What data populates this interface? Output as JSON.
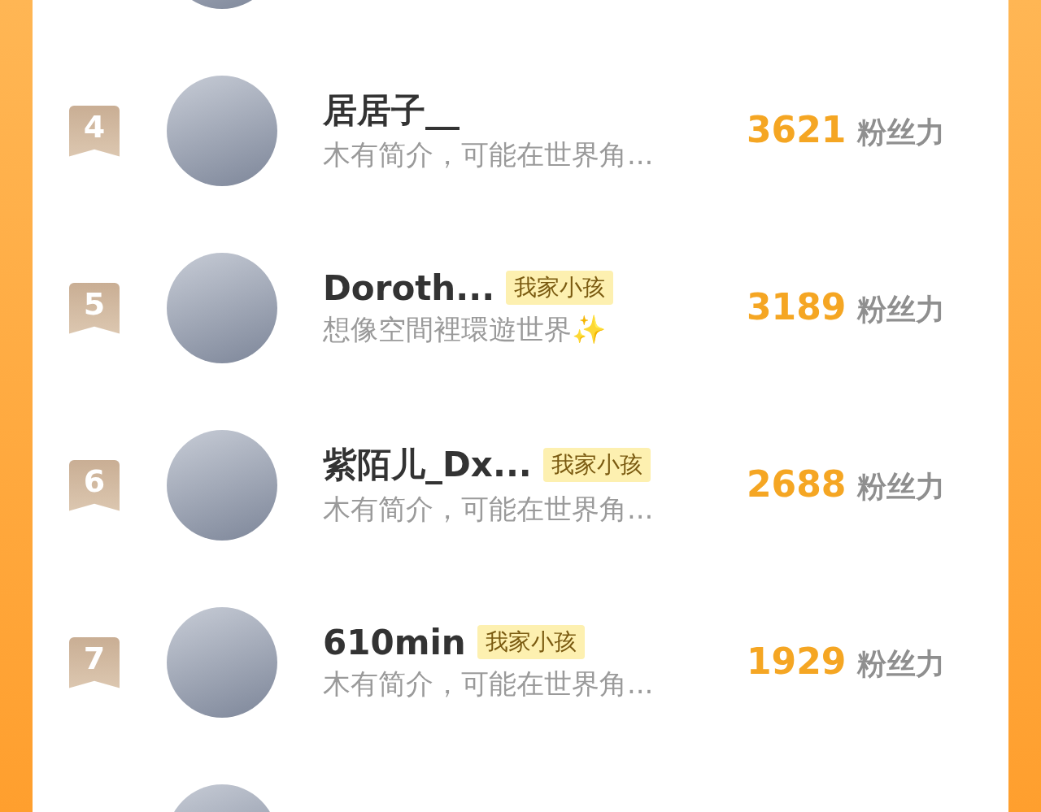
{
  "ranking": [
    {
      "rank": "4",
      "name": "居居子__",
      "bio": "木有简介，可能在世界角...",
      "score": "3621",
      "score_unit": "粉丝力"
    },
    {
      "rank": "5",
      "name": "Doroth...",
      "tag": "我家小孩",
      "bio": "想像空間裡環遊世界✨",
      "score": "3189",
      "score_unit": "粉丝力"
    },
    {
      "rank": "6",
      "name": "紫陌儿_Dx...",
      "tag": "我家小孩",
      "bio": "木有简介，可能在世界角...",
      "score": "2688",
      "score_unit": "粉丝力"
    },
    {
      "rank": "7",
      "name": "610min",
      "tag": "我家小孩",
      "bio": "木有简介，可能在世界角...",
      "score": "1929",
      "score_unit": "粉丝力"
    }
  ]
}
